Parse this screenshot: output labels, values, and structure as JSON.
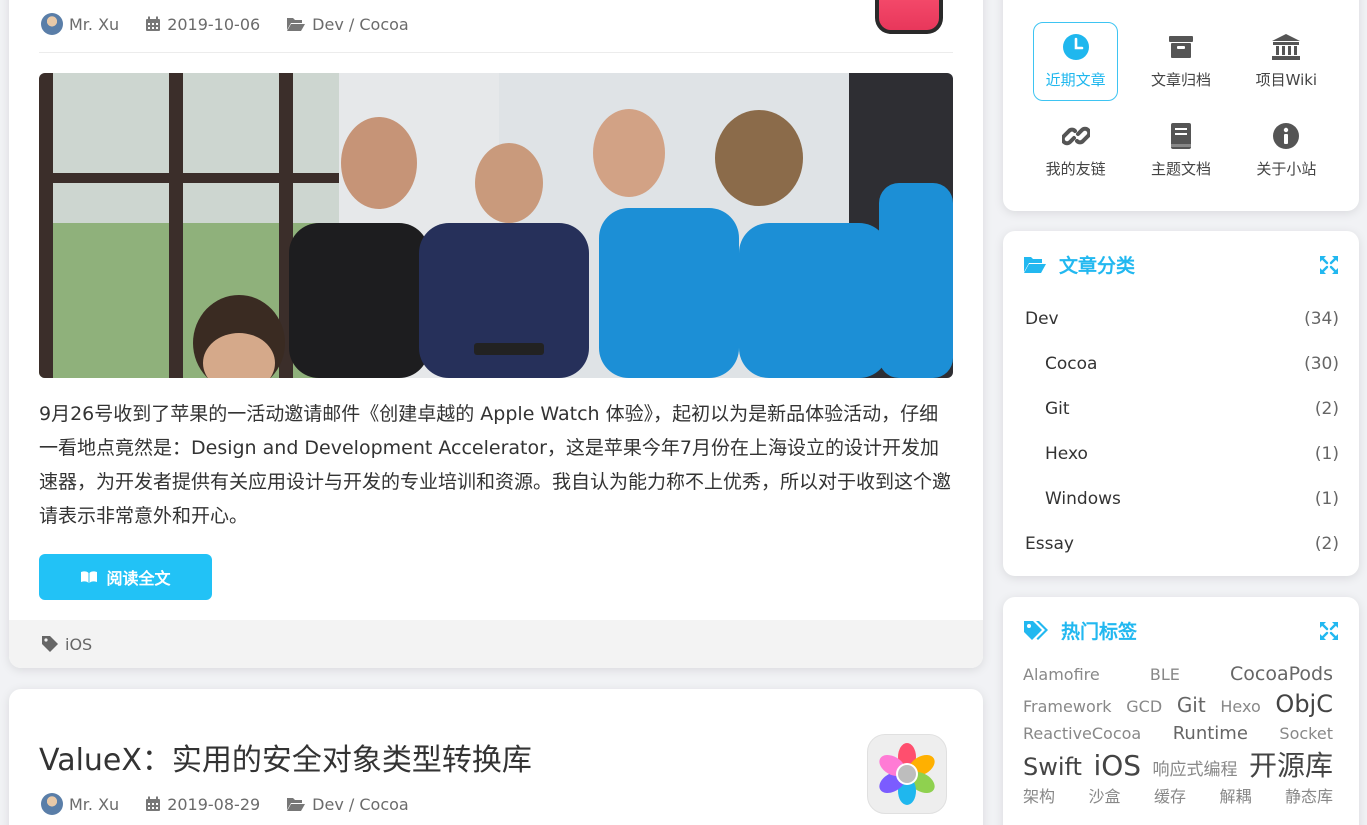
{
  "posts": [
    {
      "author": "Mr. Xu",
      "date": "2019-10-06",
      "category": "Dev / Cocoa",
      "excerpt": "9月26号收到了苹果的一活动邀请邮件《创建卓越的 Apple Watch 体验》，起初以为是新品体验活动，仔细一看地点竟然是：Design and Development Accelerator，这是苹果今年7月份在上海设立的设计开发加速器，为开发者提供有关应用设计与开发的专业培训和资源。我自认为能力称不上优秀，所以对于收到这个邀请表示非常意外和开心。",
      "read_more": "阅读全文",
      "tag": "iOS"
    },
    {
      "title": "ValueX：实用的安全对象类型转换库",
      "author": "Mr. Xu",
      "date": "2019-08-29",
      "category": "Dev / Cocoa"
    }
  ],
  "sidebar": {
    "nav": [
      {
        "label": "近期文章",
        "icon": "clock-icon",
        "active": true
      },
      {
        "label": "文章归档",
        "icon": "archive-icon"
      },
      {
        "label": "项目Wiki",
        "icon": "bank-icon"
      },
      {
        "label": "我的友链",
        "icon": "link-icon"
      },
      {
        "label": "主题文档",
        "icon": "book-icon"
      },
      {
        "label": "关于小站",
        "icon": "info-icon"
      }
    ],
    "categories_title": "文章分类",
    "categories": [
      {
        "name": "Dev",
        "count": "(34)",
        "level": 0
      },
      {
        "name": "Cocoa",
        "count": "(30)",
        "level": 1
      },
      {
        "name": "Git",
        "count": "(2)",
        "level": 1
      },
      {
        "name": "Hexo",
        "count": "(1)",
        "level": 1
      },
      {
        "name": "Windows",
        "count": "(1)",
        "level": 1
      },
      {
        "name": "Essay",
        "count": "(2)",
        "level": 0
      }
    ],
    "tags_title": "热门标签",
    "tags": [
      {
        "name": "Alamofire",
        "size": 16
      },
      {
        "name": "BLE",
        "size": 16
      },
      {
        "name": "CocoaPods",
        "size": 19
      },
      {
        "name": "Framework",
        "size": 16
      },
      {
        "name": "GCD",
        "size": 16
      },
      {
        "name": "Git",
        "size": 20
      },
      {
        "name": "Hexo",
        "size": 16
      },
      {
        "name": "ObjC",
        "size": 24
      },
      {
        "name": "ReactiveCocoa",
        "size": 16
      },
      {
        "name": "Runtime",
        "size": 18
      },
      {
        "name": "Socket",
        "size": 16
      },
      {
        "name": "Swift",
        "size": 24
      },
      {
        "name": "iOS",
        "size": 28
      },
      {
        "name": "响应式编程",
        "size": 17
      },
      {
        "name": "开源库",
        "size": 28
      },
      {
        "name": "架构",
        "size": 16
      },
      {
        "name": "沙盒",
        "size": 16
      },
      {
        "name": "缓存",
        "size": 16
      },
      {
        "name": "解耦",
        "size": 16
      },
      {
        "name": "静态库",
        "size": 16
      }
    ]
  },
  "colors": {
    "accent": "#22c2f6",
    "accent_text": "#1fb7ee"
  }
}
